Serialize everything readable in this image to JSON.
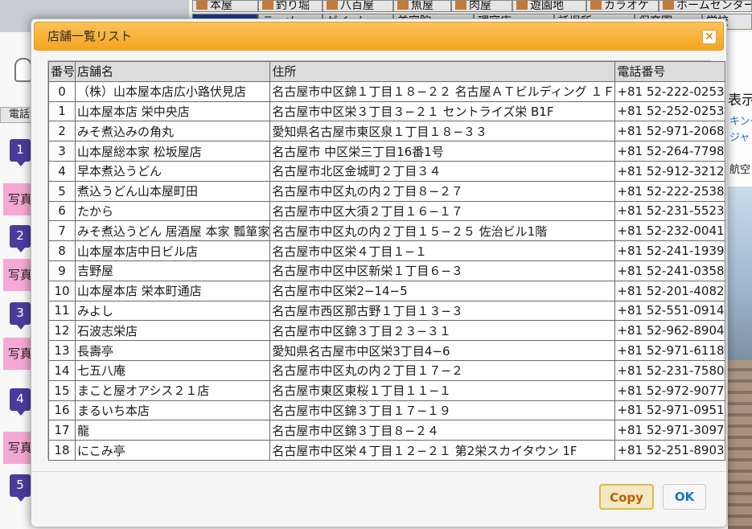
{
  "background": {
    "categories_row1": [
      "本屋",
      "釣り堀",
      "八百屋",
      "魚屋",
      "肉屋",
      "遊園地",
      "カラオケ",
      "ホームセンター"
    ],
    "categories_row2": [
      "",
      "ラーメ",
      "ゲイ─ム",
      "美容院",
      "理容店",
      "託児所",
      "保育園",
      "学校"
    ],
    "left_tel_label": "電話",
    "left_markers": [
      "1",
      "2",
      "3",
      "4",
      "5"
    ],
    "left_photo_label": "写真",
    "right_text": "表示",
    "right_links": [
      "キング",
      "ジャ",
      "航空"
    ]
  },
  "dialog": {
    "title": "店舗一覧リスト",
    "close_symbol": "✕",
    "copy_button": "Copy",
    "ok_button": "OK",
    "columns": [
      "番号",
      "店舗名",
      "住所",
      "電話番号"
    ],
    "rows": [
      [
        "0",
        "（株）山本屋本店広小路伏見店",
        "名古屋市中区錦１丁目１８−２２ 名古屋ＡＴビルディング １Ｆ",
        "+81 52-222-0253"
      ],
      [
        "1",
        "山本屋本店 栄中央店",
        "名古屋市中区栄３丁目３−２１ セントライズ栄 B1F",
        "+81 52-252-0253"
      ],
      [
        "2",
        "みそ煮込みの角丸",
        "愛知県名古屋市東区泉１丁目１８−３３",
        "+81 52-971-2068"
      ],
      [
        "3",
        "山本屋総本家 松坂屋店",
        "名古屋市 中区栄三丁目16番1号",
        "+81 52-264-7798"
      ],
      [
        "4",
        "早本煮込うどん",
        "名古屋市北区金城町２丁目３４",
        "+81 52-912-3212"
      ],
      [
        "5",
        "煮込うどん山本屋町田",
        "名古屋市中区丸の内２丁目８−２７",
        "+81 52-222-2538"
      ],
      [
        "6",
        "たから",
        "名古屋市中区大須２丁目１６−１７",
        "+81 52-231-5523"
      ],
      [
        "7",
        "みそ煮込うどん 居酒屋 本家 瓢箪家",
        "名古屋市中区丸の内２丁目１５−２５ 佐治ビル1階",
        "+81 52-232-0041"
      ],
      [
        "8",
        "山本屋本店中日ビル店",
        "名古屋市中区栄４丁目１−１",
        "+81 52-241-1939"
      ],
      [
        "9",
        "吉野屋",
        "名古屋市中区中区新栄１丁目６−３",
        "+81 52-241-0358"
      ],
      [
        "10",
        "山本屋本店 栄本町通店",
        "名古屋市中区栄2−14−5",
        "+81 52-201-4082"
      ],
      [
        "11",
        "みよし",
        "名古屋市西区那古野１丁目１３−３",
        "+81 52-551-0914"
      ],
      [
        "12",
        "石波志栄店",
        "名古屋市中区錦３丁目２３−３１",
        "+81 52-962-8904"
      ],
      [
        "13",
        "長壽亭",
        "愛知県名古屋市中区栄3丁目4−6",
        "+81 52-971-6118"
      ],
      [
        "14",
        "七五八庵",
        "名古屋市中区丸の内２丁目１７−２",
        "+81 52-231-7580"
      ],
      [
        "15",
        "まこと屋オアシス２１店",
        "名古屋市東区東桜１丁目１１−１",
        "+81 52-972-9077"
      ],
      [
        "16",
        "まるいち本店",
        "名古屋市中区錦３丁目１７−１９",
        "+81 52-971-0951"
      ],
      [
        "17",
        "龍",
        "名古屋市中区錦３丁目８−２４",
        "+81 52-971-3097"
      ],
      [
        "18",
        "にこみ亭",
        "名古屋市中区栄４丁目１２−２１ 第2栄スカイタウン 1F",
        "+81 52-251-8903"
      ]
    ]
  }
}
